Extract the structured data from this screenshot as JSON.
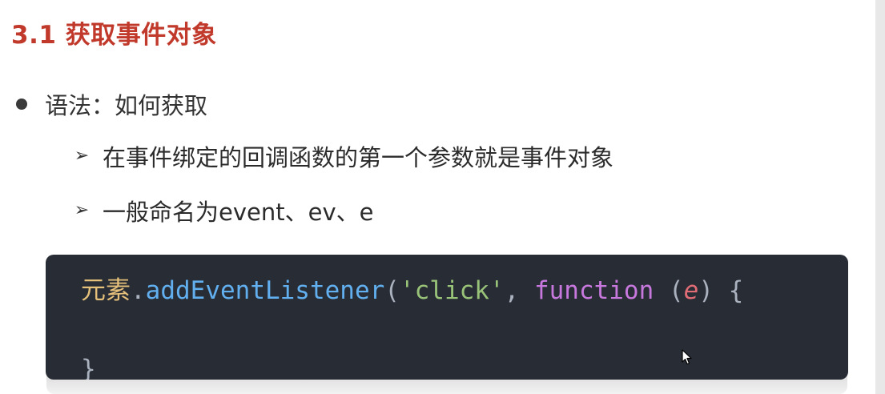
{
  "slide": {
    "title": "3.1 获取事件对象",
    "bullet": "语法：如何获取",
    "sub_items": [
      "在事件绑定的回调函数的第一个参数就是事件对象",
      "一般命名为event、ev、e"
    ],
    "arrow_glyph": "➢"
  },
  "code": {
    "line1": {
      "element": "元素",
      "dot": ".",
      "method": "addEventListener",
      "open_paren": "(",
      "event_type": "'click'",
      "comma": ", ",
      "keyword": "function",
      "space": " ",
      "param_open": "(",
      "param": "e",
      "param_close": ")",
      "brace_open": " {"
    },
    "line2": {
      "brace_close": "}"
    }
  },
  "colors": {
    "title": "#c0392b",
    "code_background": "#282c34",
    "chinese_identifier": "#e5c07b",
    "method": "#61afef",
    "string": "#98c379",
    "keyword": "#c678dd",
    "param": "#e06c75",
    "punctuation": "#abb2bf"
  },
  "icons": {
    "bullet": "bullet-dot-icon",
    "sub_bullet": "arrow-bullet-icon",
    "cursor": "mouse-cursor-icon"
  }
}
